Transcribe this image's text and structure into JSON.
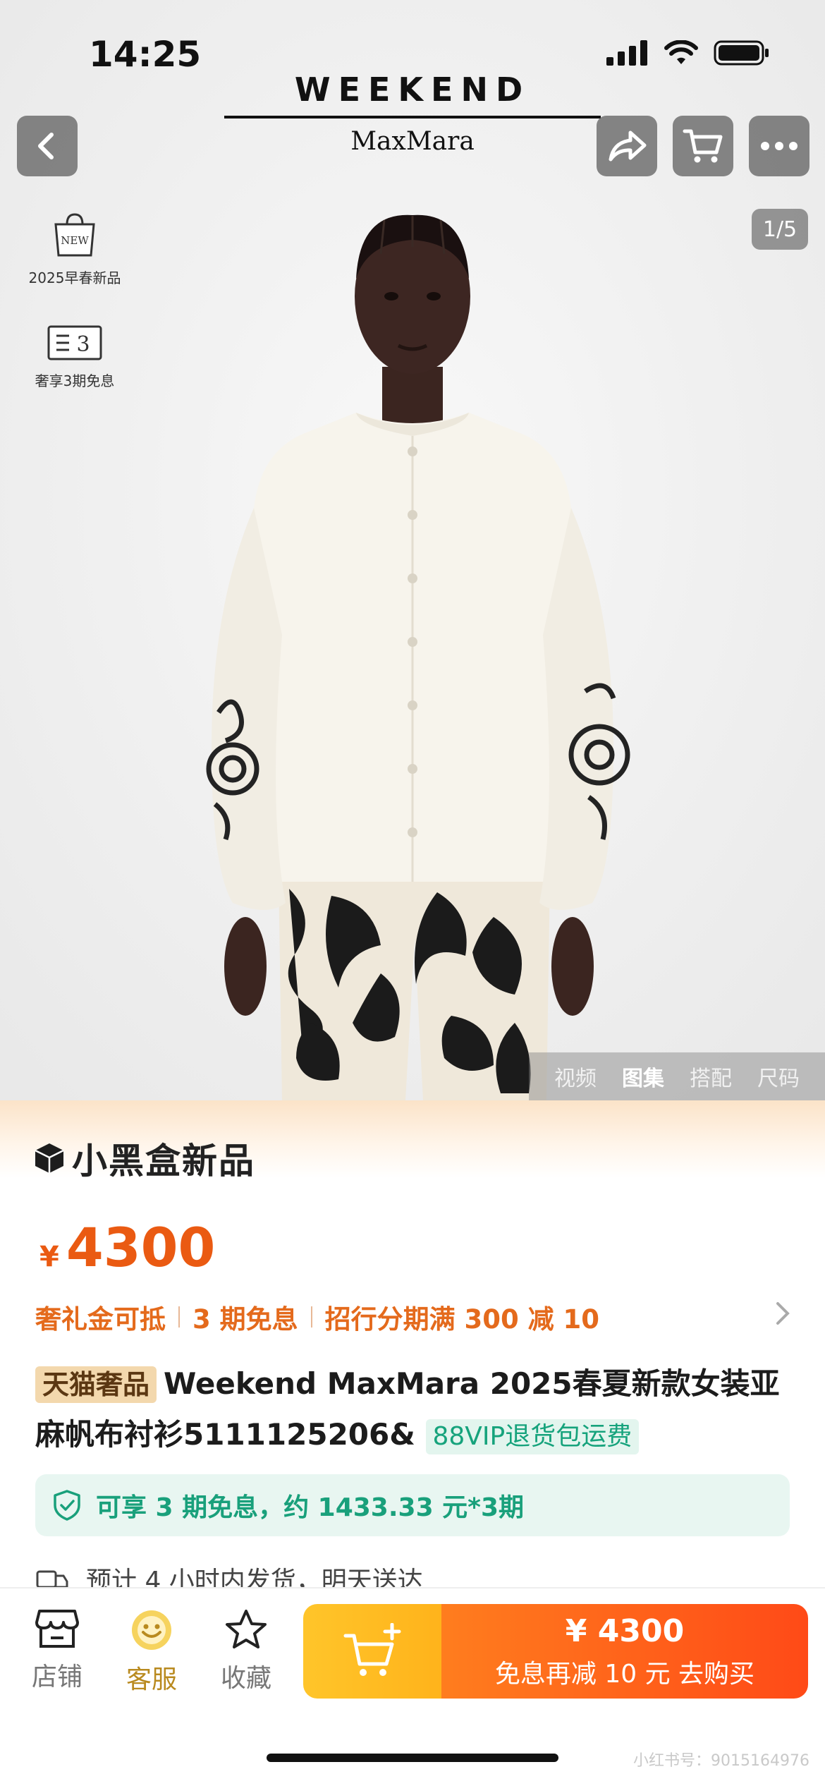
{
  "status_bar": {
    "time": "14:25"
  },
  "header": {
    "brand_top": "WEEKEND",
    "brand_bottom": "MaxMara",
    "back_icon": "chevron-left-icon",
    "share_icon": "share-icon",
    "cart_icon": "cart-icon",
    "more_icon": "more-icon"
  },
  "badges": [
    {
      "icon": "new-bag-icon",
      "icon_text": "NEW",
      "label": "2025早春新品"
    },
    {
      "icon": "installment-icon",
      "icon_text": "3",
      "label": "奢享3期免息"
    }
  ],
  "gallery": {
    "counter": "1/5",
    "tabs": [
      "视频",
      "图集",
      "搭配",
      "尺码"
    ],
    "active_tab": "图集"
  },
  "product": {
    "channel": "小黑盒新品",
    "currency": "¥",
    "price": "4300",
    "promos": [
      "奢礼金可抵",
      "3 期免息",
      "招行分期满 300 减 10"
    ],
    "tag": "天猫奢品",
    "title": "Weekend MaxMara 2025春夏新款女装亚麻帆布衬衫5111125206&",
    "vip_tag": "88VIP退货包运费",
    "installment": "可享 3 期免息，约 1433.33 元*3期",
    "shipping": "预计 4 小时内发货，明天送达"
  },
  "bottom_bar": {
    "items": [
      {
        "icon": "store-icon",
        "label": "店铺"
      },
      {
        "icon": "customer-service-icon",
        "label": "客服"
      },
      {
        "icon": "star-icon",
        "label": "收藏"
      }
    ],
    "buy_price": "¥ 4300",
    "buy_sub": "免息再减 10 元  去购买",
    "watermark": "小红书号：9015164976"
  },
  "colors": {
    "accent_orange": "#ea5a12",
    "green": "#19a07b",
    "buy_gradient": "#ff4a17"
  }
}
